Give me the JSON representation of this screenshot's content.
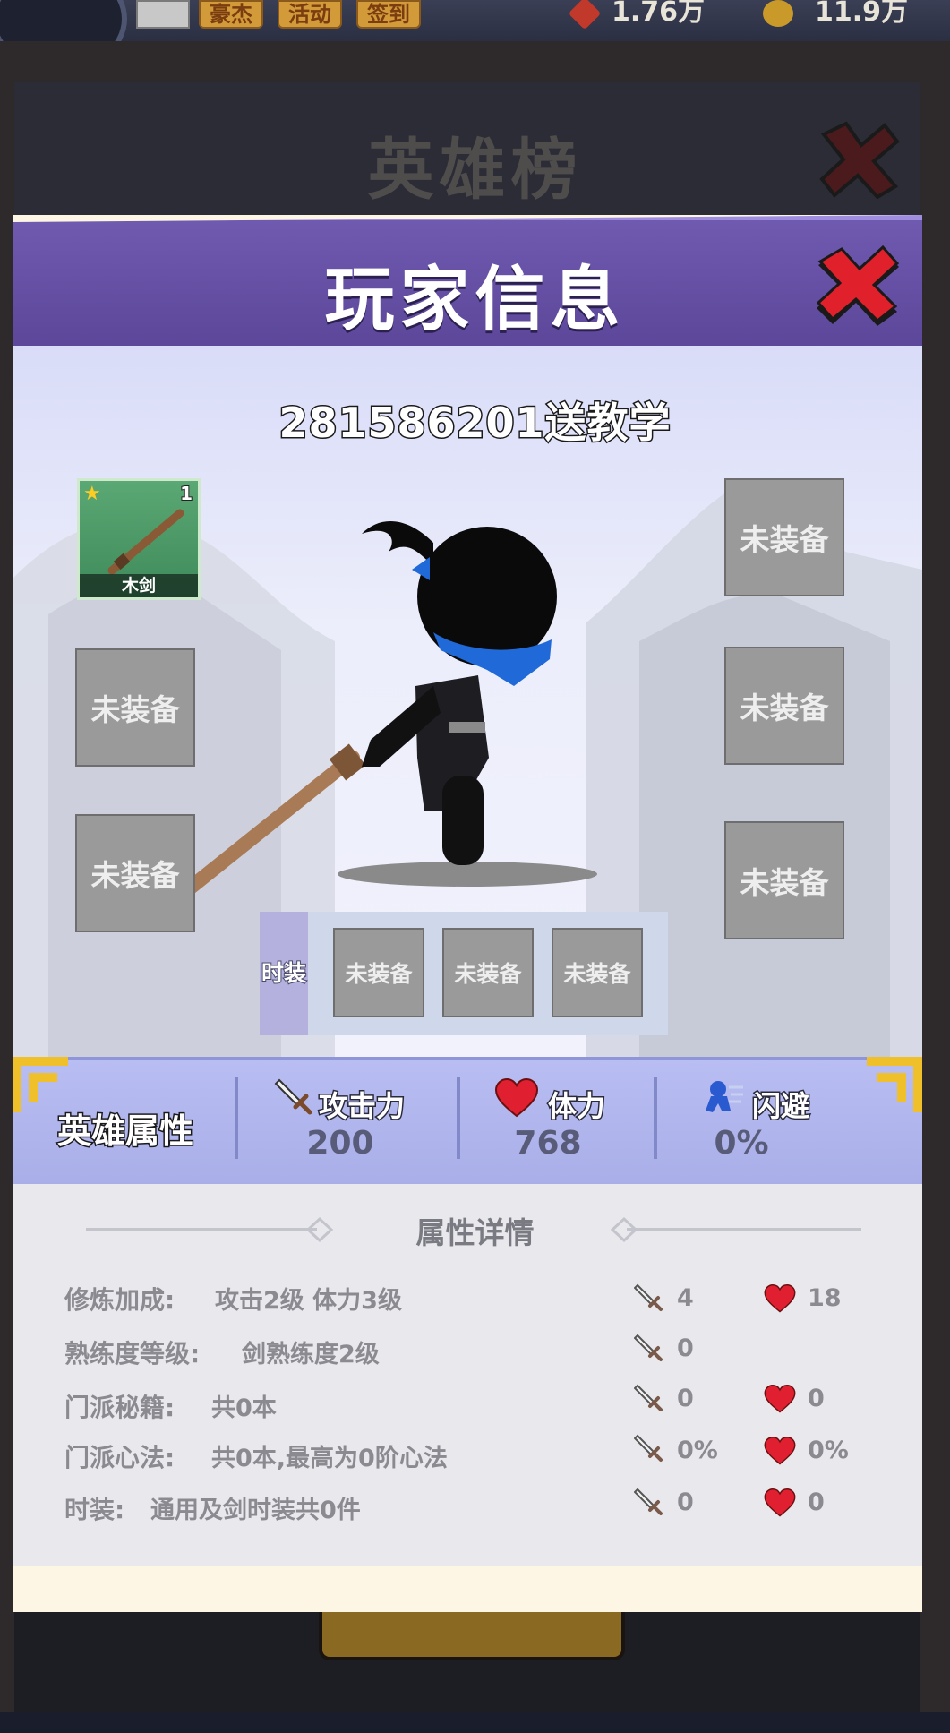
{
  "topbar": {
    "tab_hero": "豪杰",
    "tab_event": "活动",
    "tab_checkin": "签到",
    "resource1": "1.76万",
    "resource2": "11.9万"
  },
  "leaderboard": {
    "title": "英雄榜"
  },
  "modal": {
    "title": "玩家信息",
    "player_name": "281586201送教学",
    "weapon": {
      "name": "木剑",
      "level": "1"
    },
    "empty_slot": "未装备",
    "costume_label": "时装"
  },
  "attributes": {
    "title": "英雄属性",
    "attack_label": "攻击力",
    "attack_value": "200",
    "hp_label": "体力",
    "hp_value": "768",
    "dodge_label": "闪避",
    "dodge_value": "0%"
  },
  "details": {
    "title": "属性详情",
    "rows": [
      {
        "label": "修炼加成:",
        "text": "攻击2级 体力3级",
        "atk": "4",
        "hp": "18"
      },
      {
        "label": "熟练度等级:",
        "text": "剑熟练度2级",
        "atk": "0",
        "hp": ""
      },
      {
        "label": "门派秘籍:",
        "text": "共0本",
        "atk": "0",
        "hp": "0"
      },
      {
        "label": "门派心法:",
        "text": "共0本,最高为0阶心法",
        "atk": "0%",
        "hp": "0%"
      },
      {
        "label": "时装:",
        "text": "通用及剑时装共0件",
        "atk": "0",
        "hp": "0"
      }
    ]
  },
  "colors": {
    "header": "#6f5ab0",
    "attr_bar": "#b8bdf2",
    "close": "#e0202a"
  }
}
